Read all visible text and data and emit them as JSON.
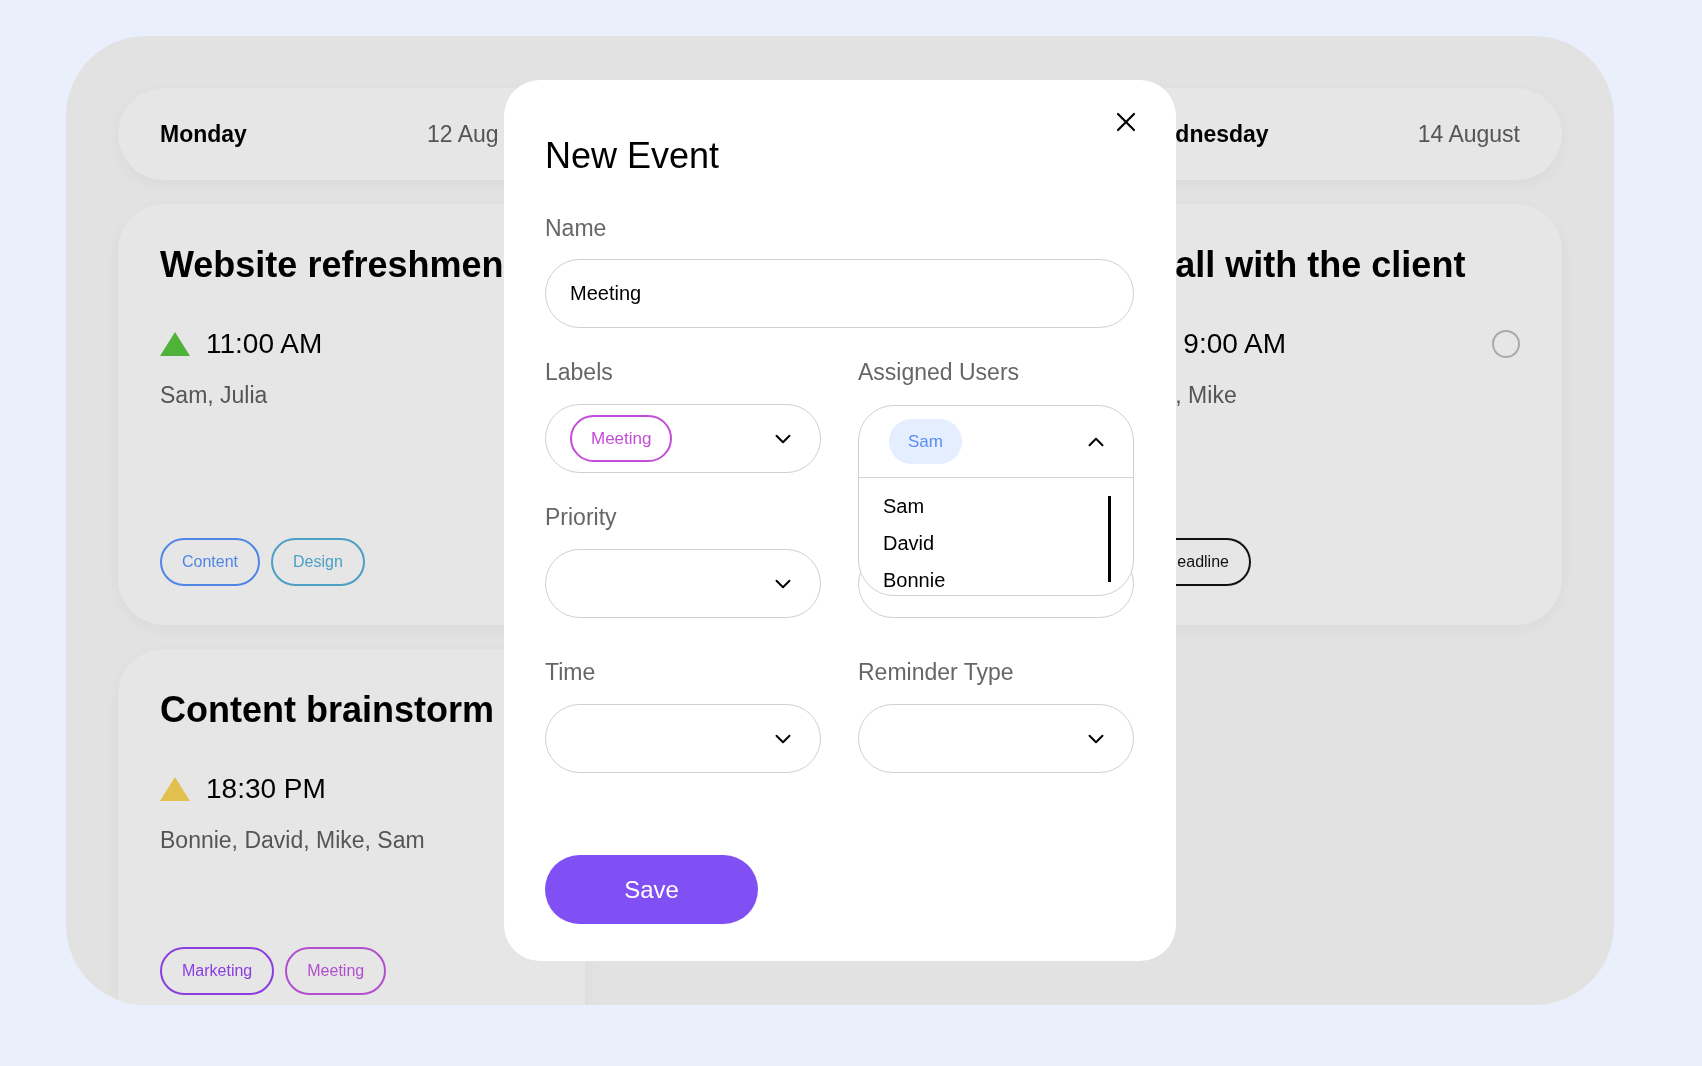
{
  "columns": [
    {
      "day": "Monday",
      "date": "12 Aug",
      "cards": [
        {
          "title": "Website refreshmen",
          "color": "#4fb33a",
          "time": "11:00 AM",
          "people": "Sam, Julia",
          "tags": [
            {
              "label": "Content",
              "color": "#4f86e6"
            },
            {
              "label": "Design",
              "color": "#4d9fc4"
            }
          ]
        },
        {
          "title": "Content brainstorm",
          "color": "#e2c04e",
          "time": "18:30 PM",
          "people": "Bonnie, David, Mike, Sam",
          "tags": [
            {
              "label": "Marketing",
              "color": "#8a3ee0"
            },
            {
              "label": "Meeting",
              "color": "#b24fd1"
            }
          ]
        }
      ]
    },
    {
      "day": "dnesday",
      "date": "14 August",
      "cards": [
        {
          "title": "all with the client",
          "time": "9:00 AM",
          "people": ", Mike",
          "checked": false,
          "tags": [
            {
              "label": "eadline",
              "color": "#111111"
            }
          ]
        }
      ]
    }
  ],
  "dialog": {
    "title": "New Event",
    "name": {
      "label": "Name",
      "value": "Meeting"
    },
    "labels": {
      "label": "Labels",
      "expanded": false,
      "chips": [
        {
          "label": "Meeting",
          "color": "#c24dd6"
        }
      ]
    },
    "assigned": {
      "label": "Assigned Users",
      "expanded": true,
      "chips": [
        {
          "label": "Sam",
          "color": "#5b8ef5"
        }
      ],
      "options": [
        {
          "label": "Sam"
        },
        {
          "label": "David"
        },
        {
          "label": "Bonnie"
        }
      ]
    },
    "priority": {
      "label": "Priority",
      "expanded": false
    },
    "time": {
      "label": "Time",
      "expanded": false
    },
    "reminder": {
      "label": "Reminder Type",
      "expanded": false
    },
    "save": "Save"
  }
}
